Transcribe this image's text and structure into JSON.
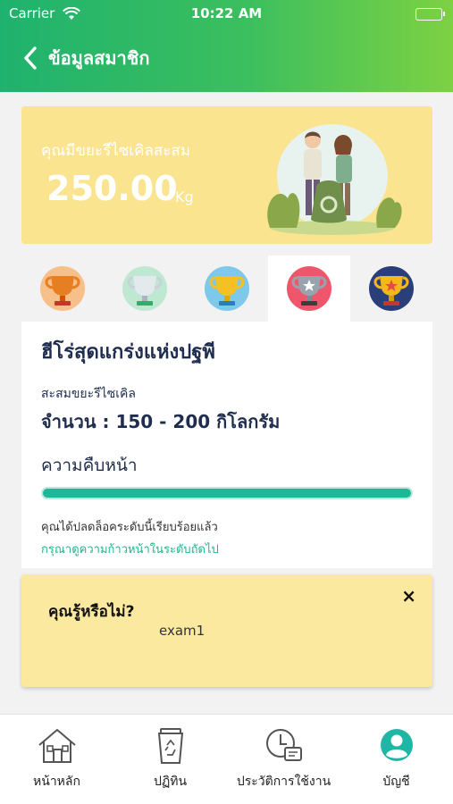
{
  "status_bar": {
    "carrier": "Carrier",
    "time": "10:22 AM"
  },
  "header": {
    "title": "ข้อมูลสมาชิก",
    "back_icon": "chevron-left-icon"
  },
  "summary": {
    "label": "คุณมีขยะรีไซเคิลสะสม",
    "amount": "250.00",
    "unit": "Kg",
    "background": "#fbe48f"
  },
  "level_tabs": [
    {
      "icon": "bronze-trophy-icon",
      "active": false
    },
    {
      "icon": "silver-trophy-icon",
      "active": false
    },
    {
      "icon": "gold-trophy-icon",
      "active": false
    },
    {
      "icon": "platinum-trophy-icon",
      "active": true
    },
    {
      "icon": "champion-trophy-icon",
      "active": false
    }
  ],
  "level_card": {
    "title": "ฮีโร่สุดแกร่งแห่งปฐพี",
    "sub_label": "สะสมขยะรีไซเคิล",
    "range": "จำนวน : 150 - 200 กิโลกรัม",
    "progress_label": "ความคืบหน้า",
    "progress": 1.0,
    "unlocked_message": "คุณได้ปลดล็อคระดับนี้เรียบร้อยแล้ว",
    "next_message": "กรุณาดูความก้าวหน้าในระดับถัดไป",
    "accent": "#1db897"
  },
  "tip": {
    "title": "คุณรู้หรือไม่?",
    "body": "exam1",
    "close_label": "×"
  },
  "tabbar": {
    "items": [
      {
        "label": "หน้าหลัก",
        "icon": "home-icon"
      },
      {
        "label": "ปฏิทิน",
        "icon": "recycle-bin-icon"
      },
      {
        "label": "ประวัติการใช้งาน",
        "icon": "history-clock-icon"
      },
      {
        "label": "บัญชี",
        "icon": "account-avatar-icon"
      }
    ]
  }
}
